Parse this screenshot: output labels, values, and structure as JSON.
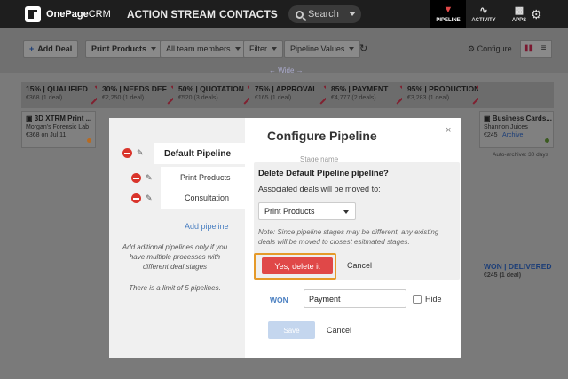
{
  "app": {
    "logo_bold": "OnePage",
    "logo_light": "CRM"
  },
  "nav": {
    "action_stream": "ACTION STREAM",
    "contacts": "CONTACTS",
    "search_placeholder": "Search",
    "tabs": [
      {
        "label": "PIPELINE",
        "active": true
      },
      {
        "label": "ACTIVITY",
        "active": false
      },
      {
        "label": "APPS",
        "active": false
      }
    ]
  },
  "toolbar": {
    "add_deal": "Add Deal",
    "pipeline_select": "Print Products",
    "team_select": "All team members",
    "filter": "Filter",
    "pipeline_values": "Pipeline Values",
    "configure": "Configure",
    "wide_toggle": "← Wide →"
  },
  "stages": [
    {
      "title": "15% | QUALIFIED",
      "amount": "€368",
      "deals": "(1 deal)"
    },
    {
      "title": "30% | NEEDS DEF",
      "amount": "€2,250",
      "deals": "(1 deal)"
    },
    {
      "title": "50% | QUOTATION",
      "amount": "€520",
      "deals": "(3 deals)"
    },
    {
      "title": "75% | APPROVAL",
      "amount": "€165",
      "deals": "(1 deal)"
    },
    {
      "title": "85% | PAYMENT",
      "amount": "€4,777",
      "deals": "(2 deals)"
    },
    {
      "title": "95% | PRODUCTION",
      "amount": "€3,283",
      "deals": "(1 deal)"
    },
    {
      "title": "WON | DELIVERED",
      "amount": "€245",
      "deals": "(1 deal)"
    }
  ],
  "cards": [
    {
      "title": "3D XTRM Print ...",
      "company": "Morgan's Forensic Lab",
      "amount": "€368 on Jul 11"
    },
    {
      "title": "Business Cards...",
      "company": "Shannon Juices",
      "amount": "€245",
      "status": "Archive"
    }
  ],
  "auto_archive": "Auto-archive: 30 days",
  "modal": {
    "title": "Configure Pipeline",
    "close": "×",
    "stage_name_header": "Stage name",
    "pipelines": [
      "Default Pipeline",
      "Print Products",
      "Consultation"
    ],
    "add_pipeline": "Add pipeline",
    "help_text": "Add aditional pipelines only if you have multiple processes with different deal stages",
    "limit_text": "There is a limit of 5 pipelines.",
    "confirm": {
      "title": "Delete Default Pipeline pipeline?",
      "subtitle": "Associated deals will be moved to:",
      "selected": "Print Products",
      "note": "Note: Since pipeline stages may be different, any existing deals will be moved to closest esitmated stages.",
      "yes": "Yes, delete it",
      "cancel": "Cancel"
    },
    "won_label": "WON",
    "won_value": "Payment",
    "hide_label": "Hide",
    "save": "Save",
    "cancel": "Cancel"
  },
  "colors": {
    "danger": "#e04848",
    "link": "#4a7fc1",
    "highlight": "#e59a2a"
  }
}
